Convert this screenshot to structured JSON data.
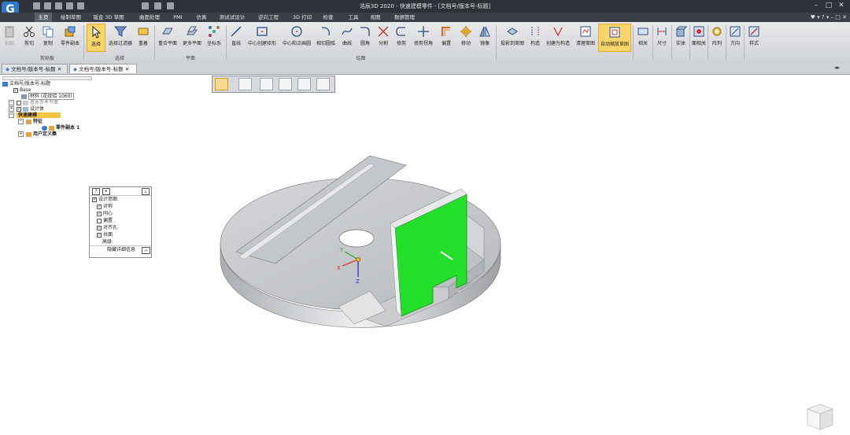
{
  "app": {
    "title": "浩辰3D 2020 - 快速建模零件 - [文档号/版本号-标题]",
    "logo_letter": "G"
  },
  "ribbon_tabs": [
    "主页",
    "绘制草图",
    "钣金 3D 草图",
    "曲面处理",
    "PMI",
    "仿真",
    "测试试设计",
    "逆向工程",
    "3D 打印",
    "检查",
    "工具",
    "视图",
    "数据管理"
  ],
  "ribbon": {
    "clipboard": {
      "group": "剪贴板",
      "buttons": [
        "粘贴",
        "剪切",
        "复制",
        "零件副本"
      ]
    },
    "select": {
      "group": "选择",
      "buttons": [
        "选择",
        "选择过滤器",
        "重着"
      ]
    },
    "plane": {
      "group": "平面",
      "buttons": [
        "重合平面",
        "更多平面",
        "坐标系"
      ]
    },
    "draw": {
      "group": "绘图",
      "buttons": [
        "直线",
        "中心创建矩形",
        "中心和点画圆",
        "相切圆弧",
        "曲线",
        "圆角",
        "分割",
        "修剪",
        "修剪拐角",
        "偏置",
        "移动",
        "镜像"
      ]
    },
    "right": {
      "buttons": [
        "投影到草图",
        "构造",
        "创建为构造",
        "清理草图",
        "自动缩放草图",
        "相关",
        "尺寸",
        "实体",
        "面相关",
        "阵列",
        "方向",
        "样式"
      ]
    }
  },
  "doc_tabs": [
    "文档号/版本号-标题",
    "文档号/版本号-标题"
  ],
  "tree": {
    "root": "文档号/版本号-标题",
    "items": [
      "Base",
      "材料 (花纹铝 1060)",
      "基本参考平面",
      "设计体",
      "快速建模",
      "特征",
      "零件副本 1",
      "用户定义集"
    ]
  },
  "float_panel": {
    "title": "设计意图",
    "options": [
      {
        "label": "对称",
        "checked": true
      },
      {
        "label": "同心",
        "checked": true
      },
      {
        "label": "偏置",
        "checked": false
      },
      {
        "label": "对齐孔",
        "checked": true
      },
      {
        "label": "共面",
        "checked": true
      },
      {
        "label": "高级",
        "checked": false
      }
    ],
    "footer": "隐藏详细信息"
  },
  "triad_labels": {
    "x": "X",
    "y": "Y",
    "z": "Z"
  },
  "colors": {
    "accent": "#f9d56a",
    "highlight_face": "#22e02a",
    "titlebar": "#2e3238"
  }
}
